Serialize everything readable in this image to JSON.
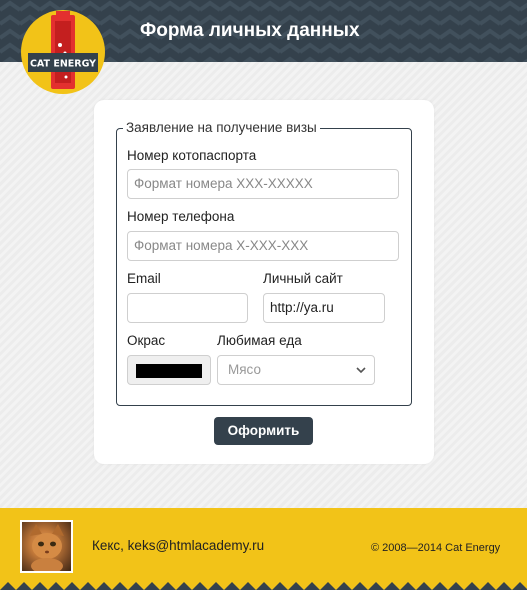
{
  "header": {
    "title": "Форма личных данных",
    "logo_text": "CAT ENERGY"
  },
  "form": {
    "legend": "Заявление на получение визы",
    "passport": {
      "label": "Номер котопаспорта",
      "placeholder": "Формат номера XXX-XXXXX",
      "value": ""
    },
    "phone": {
      "label": "Номер телефона",
      "placeholder": "Формат номера X-XXX-XXX",
      "value": ""
    },
    "email": {
      "label": "Email",
      "value": ""
    },
    "site": {
      "label": "Личный сайт",
      "value": "http://ya.ru"
    },
    "color": {
      "label": "Окрас",
      "value": "#000000"
    },
    "food": {
      "label": "Любимая еда",
      "selected": "Мясо"
    },
    "submit_label": "Оформить"
  },
  "footer": {
    "user": "Кекс, keks@htmlacademy.ru",
    "copyright": "© 2008—2014 Cat Energy"
  },
  "colors": {
    "dark": "#34414c",
    "accent": "#f2c318",
    "logo_red": "#e3302f"
  }
}
